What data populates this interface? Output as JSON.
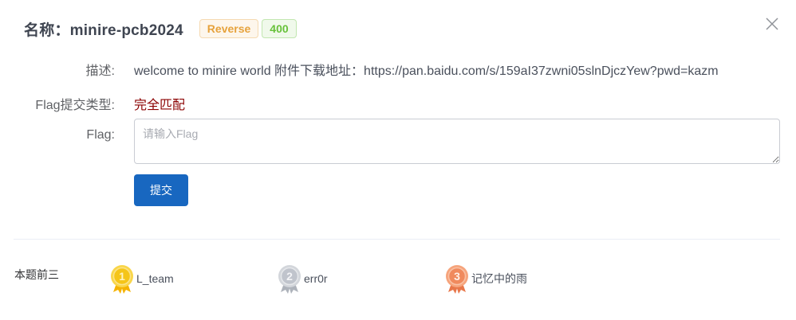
{
  "dialog": {
    "title": "名称：minire-pcb2024",
    "category_tag": "Reverse",
    "score_tag": "400",
    "close_icon": "close-icon"
  },
  "form": {
    "desc_label": "描述:",
    "desc_value": "welcome to minire world 附件下载地址：https://pan.baidu.com/s/159aI37zwni05slnDjczYew?pwd=kazm",
    "type_label": "Flag提交类型:",
    "type_value": "完全匹配",
    "flag_label": "Flag:",
    "flag_placeholder": "请输入Flag",
    "flag_value": "",
    "submit_label": "提交"
  },
  "leaderboard": {
    "label": "本题前三",
    "entries": [
      {
        "rank": "1",
        "name": "L_team",
        "medal": "gold-medal-icon"
      },
      {
        "rank": "2",
        "name": "err0r",
        "medal": "silver-medal-icon"
      },
      {
        "rank": "3",
        "name": "记忆中的雨",
        "medal": "bronze-medal-icon"
      }
    ]
  },
  "colors": {
    "primary": "#1867c0",
    "warning_tag": "#e6a23c",
    "success_tag": "#67c23a",
    "match_text": "#8b0000",
    "gold": "#f5c518",
    "silver": "#c0c4cc",
    "bronze": "#f08a5d"
  }
}
